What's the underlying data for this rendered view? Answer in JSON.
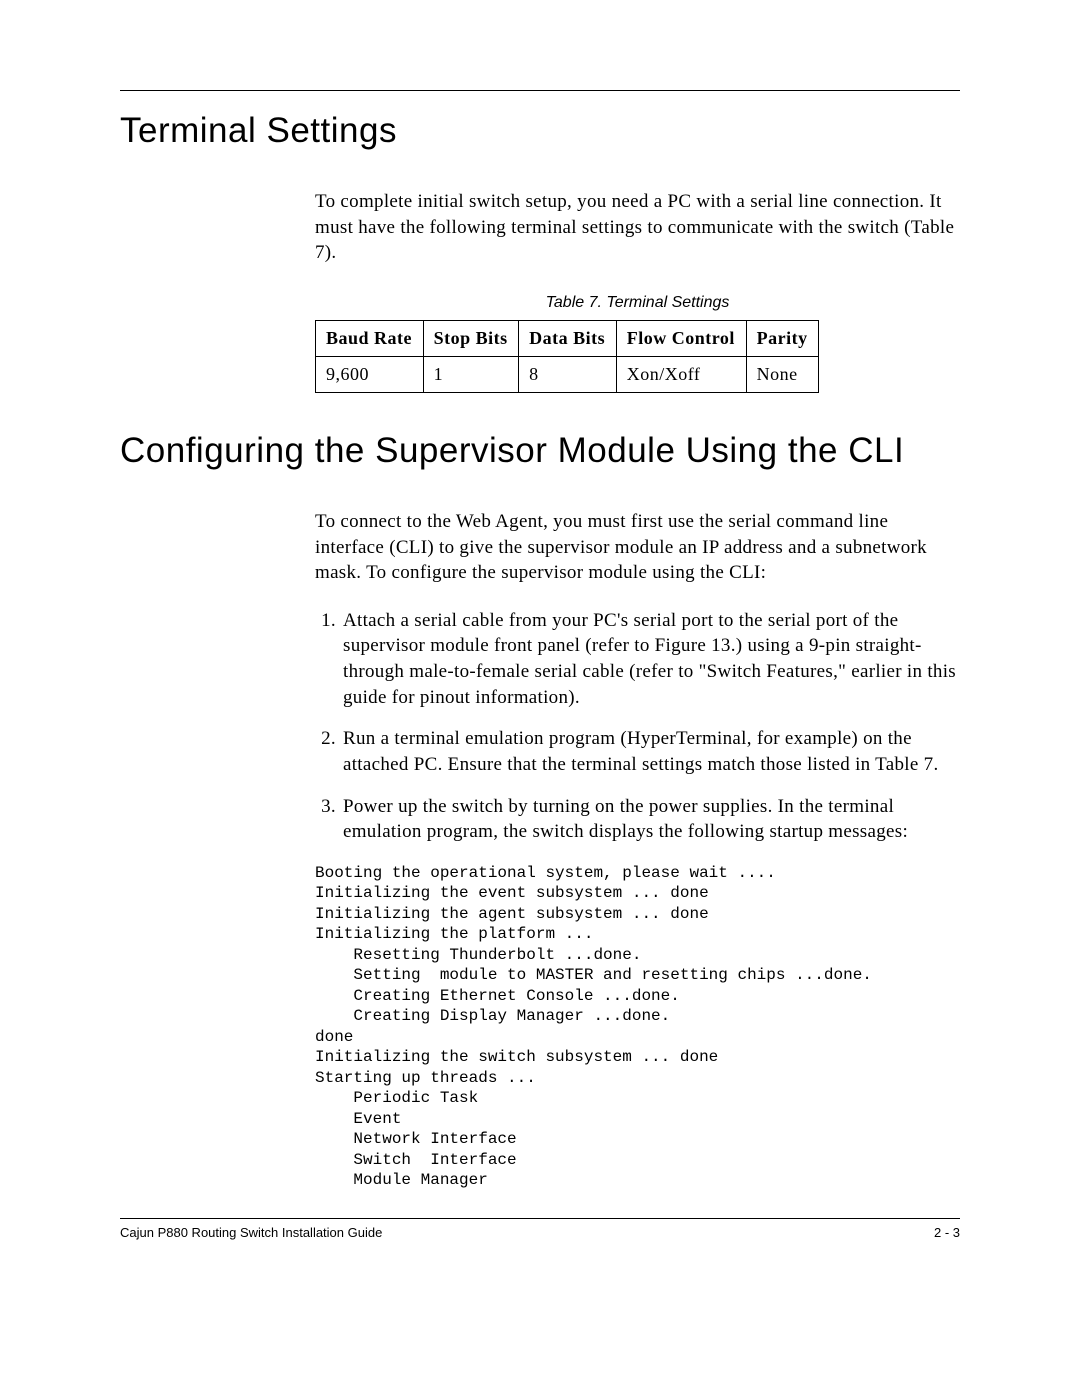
{
  "section1": {
    "heading": "Terminal Settings",
    "intro": "To complete initial switch setup, you need a PC with a serial line connection. It must have the following terminal settings to communicate with the switch (Table 7).",
    "table_caption": "Table 7.  Terminal Settings",
    "table": {
      "headers": [
        "Baud Rate",
        "Stop Bits",
        "Data Bits",
        "Flow Control",
        "Parity"
      ],
      "row": [
        "9,600",
        "1",
        "8",
        "Xon/Xoff",
        "None"
      ]
    }
  },
  "chart_data": {
    "type": "table",
    "title": "Table 7. Terminal Settings",
    "columns": [
      "Baud Rate",
      "Stop Bits",
      "Data Bits",
      "Flow Control",
      "Parity"
    ],
    "rows": [
      {
        "Baud Rate": "9,600",
        "Stop Bits": 1,
        "Data Bits": 8,
        "Flow Control": "Xon/Xoff",
        "Parity": "None"
      }
    ]
  },
  "section2": {
    "heading": "Configuring the Supervisor Module Using the CLI",
    "intro": "To connect to the Web Agent, you must first use the serial command line interface (CLI) to give the supervisor module an IP address and a subnetwork mask. To configure the supervisor module using the CLI:",
    "steps": [
      "Attach a serial cable from your PC's serial port to the serial port of the supervisor module front panel (refer to Figure 13.) using a 9-pin straight-through male-to-female serial cable (refer to \"Switch Features,\" earlier in this guide for pinout information).",
      "Run a terminal emulation program (HyperTerminal, for example) on the attached PC. Ensure that the terminal settings match those listed in Table 7.",
      "Power up the switch by turning on the power supplies. In the terminal emulation program, the switch displays the following startup messages:"
    ],
    "code": "Booting the operational system, please wait ....\nInitializing the event subsystem ... done\nInitializing the agent subsystem ... done\nInitializing the platform ...\n    Resetting Thunderbolt ...done.\n    Setting  module to MASTER and resetting chips ...done.\n    Creating Ethernet Console ...done.\n    Creating Display Manager ...done.\ndone\nInitializing the switch subsystem ... done\nStarting up threads ...\n    Periodic Task\n    Event\n    Network Interface\n    Switch  Interface\n    Module Manager"
  },
  "footer": {
    "left": "Cajun P880 Routing Switch Installation Guide",
    "right": "2 - 3"
  }
}
